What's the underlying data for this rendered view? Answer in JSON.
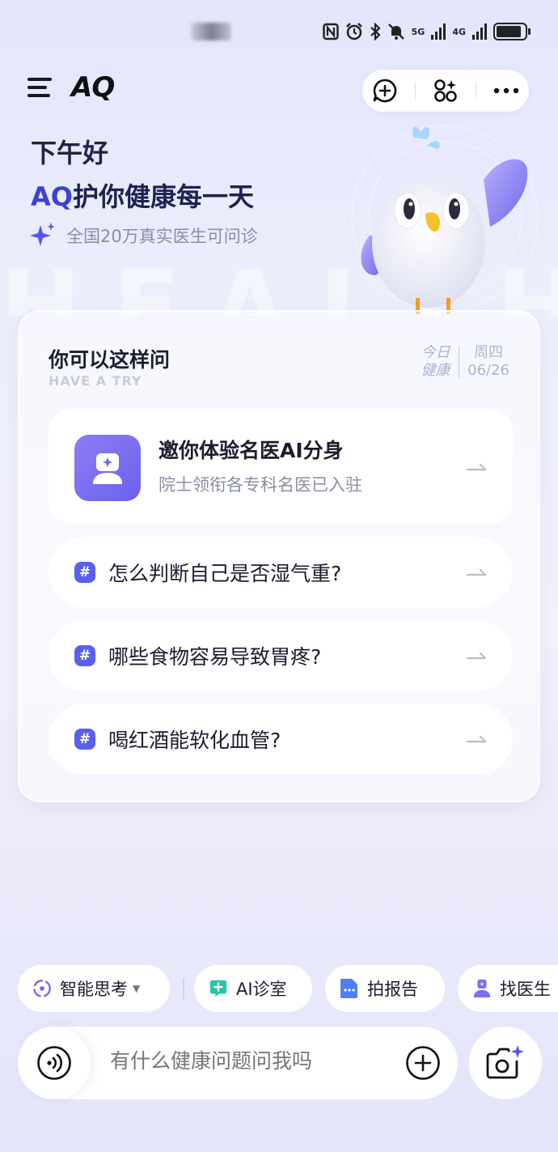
{
  "status_bar": {
    "network_5g": "5G",
    "network_4g": "4G",
    "icons": [
      "nfc-icon",
      "alarm-icon",
      "bluetooth-icon",
      "mute-icon",
      "signal-5g-icon",
      "signal-4g-icon",
      "battery-icon"
    ],
    "battery_level": 0.9
  },
  "header": {
    "logo": "AQ",
    "actions": [
      "new-chat-icon",
      "apps-icon",
      "more-icon"
    ]
  },
  "greeting": {
    "hello": "下午好",
    "tagline_brand": "AQ",
    "tagline_rest": "护你健康每一天",
    "subtitle": "全国20万真实医生可问诊"
  },
  "background_text": "HEALTH",
  "card": {
    "title": "你可以这样问",
    "subtitle": "HAVE A TRY",
    "today_label_line1": "今日",
    "today_label_line2": "健康",
    "weekday": "周四",
    "date": "06/26",
    "feature": {
      "title": "邀你体验名医AI分身",
      "description": "院士领衔各专科名医已入驻"
    },
    "questions": [
      {
        "hash": "#",
        "text": "怎么判断自己是否湿气重?"
      },
      {
        "hash": "#",
        "text": "哪些食物容易导致胃疼?"
      },
      {
        "hash": "#",
        "text": "喝红酒能软化血管?"
      }
    ]
  },
  "chips": [
    {
      "label": "智能思考",
      "icon": "thinking-icon",
      "has_dropdown": true
    },
    {
      "label": "AI诊室",
      "icon": "ai-clinic-icon"
    },
    {
      "label": "拍报告",
      "icon": "report-icon"
    },
    {
      "label": "找医生",
      "icon": "doctor-icon"
    }
  ],
  "input": {
    "placeholder": "有什么健康问题问我吗"
  },
  "colors": {
    "accent": "#3c42d6",
    "hash_badge": "#5a5ff0",
    "feature_icon": "#7a6ff2",
    "ai_clinic": "#22c9a6",
    "report": "#4f7ef5"
  }
}
